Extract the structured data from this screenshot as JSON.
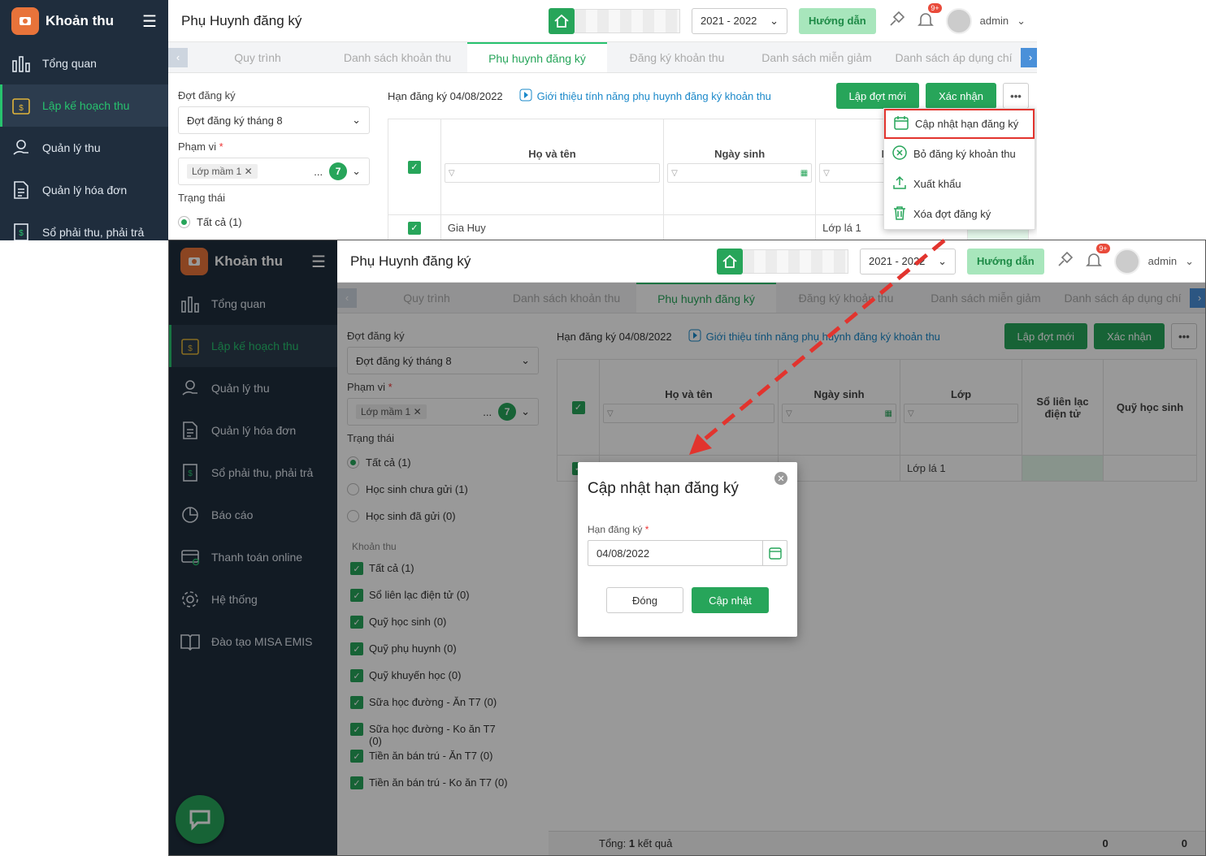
{
  "app": {
    "name": "Khoản thu",
    "page_title": "Phụ Huynh đăng ký",
    "year": "2021 - 2022",
    "guide": "Hướng dẫn",
    "user": "admin",
    "notif": "9+"
  },
  "nav": [
    {
      "label": "Tổng quan",
      "icon": "bar-chart-icon"
    },
    {
      "label": "Lập kế hoạch thu",
      "icon": "calendar-money-icon"
    },
    {
      "label": "Quản lý thu",
      "icon": "hand-coin-icon"
    },
    {
      "label": "Quản lý hóa đơn",
      "icon": "invoice-icon"
    },
    {
      "label": "Sổ phải thu, phải trả",
      "icon": "ledger-icon"
    },
    {
      "label": "Báo cáo",
      "icon": "pie-chart-icon"
    },
    {
      "label": "Thanh toán online",
      "icon": "card-payment-icon"
    },
    {
      "label": "Hệ thống",
      "icon": "gear-icon"
    },
    {
      "label": "Đào tạo MISA EMIS",
      "icon": "book-icon"
    }
  ],
  "tabs": [
    "Quy trình",
    "Danh sách khoản thu",
    "Phụ huynh đăng ký",
    "Đăng ký khoản thu",
    "Danh sách miễn giảm",
    "Danh sách áp dụng chí"
  ],
  "filters": {
    "period_label": "Đợt đăng ký",
    "period_value": "Đợt đăng ký tháng 8",
    "scope_label": "Phạm vi",
    "scope_required": "*",
    "scope_chip": "Lớp mầm 1",
    "scope_more": "...",
    "scope_count": "7",
    "status_label": "Trạng thái",
    "status_options": [
      "Tất cả (1)",
      "Học sinh chưa gửi (1)",
      "Học sinh đã gửi (0)"
    ],
    "fees_label": "Khoản thu",
    "fees": [
      "Tất cả (1)",
      "Sổ liên lạc điện tử (0)",
      "Quỹ học sinh (0)",
      "Quỹ phụ huynh (0)",
      "Quỹ khuyến học (0)",
      "Sữa học đường - Ăn T7 (0)",
      "Sữa học đường - Ko ăn T7 (0)",
      "Tiền ăn bán trú - Ăn T7 (0)",
      "Tiền ăn bán trú - Ko ăn T7 (0)"
    ]
  },
  "main": {
    "deadline": "Hạn đăng ký 04/08/2022",
    "intro": "Giới thiệu tính năng phụ huynh đăng ký khoản thu",
    "btn_new": "Lập đợt mới",
    "btn_confirm": "Xác nhận",
    "btn_more": "•••",
    "columns": [
      "Họ và tên",
      "Ngày sinh",
      "Lớp",
      "Sổ liên lạc điện tử",
      "Quỹ học sinh"
    ],
    "row": {
      "name": "Gia Huy",
      "dob": "",
      "class": "Lớp lá 1"
    },
    "footer_label": "Tổng:",
    "footer_count": "1",
    "footer_suffix": "kết quả",
    "footer_v1": "0",
    "footer_v2": "0"
  },
  "menu": [
    {
      "label": "Cập nhật hạn đăng ký",
      "icon": "calendar-icon"
    },
    {
      "label": "Bỏ đăng ký khoản thu",
      "icon": "cancel-circle-icon"
    },
    {
      "label": "Xuất khẩu",
      "icon": "export-icon"
    },
    {
      "label": "Xóa đợt đăng ký",
      "icon": "trash-icon"
    }
  ],
  "dialog": {
    "title": "Cập nhật hạn đăng ký",
    "field_label": "Hạn đăng ký",
    "required": "*",
    "date": "04/08/2022",
    "btn_close": "Đóng",
    "btn_update": "Cập nhật"
  },
  "colors": {
    "accent": "#27a55a",
    "sidebar": "#1f2d3d",
    "highlight": "#e2342e"
  }
}
